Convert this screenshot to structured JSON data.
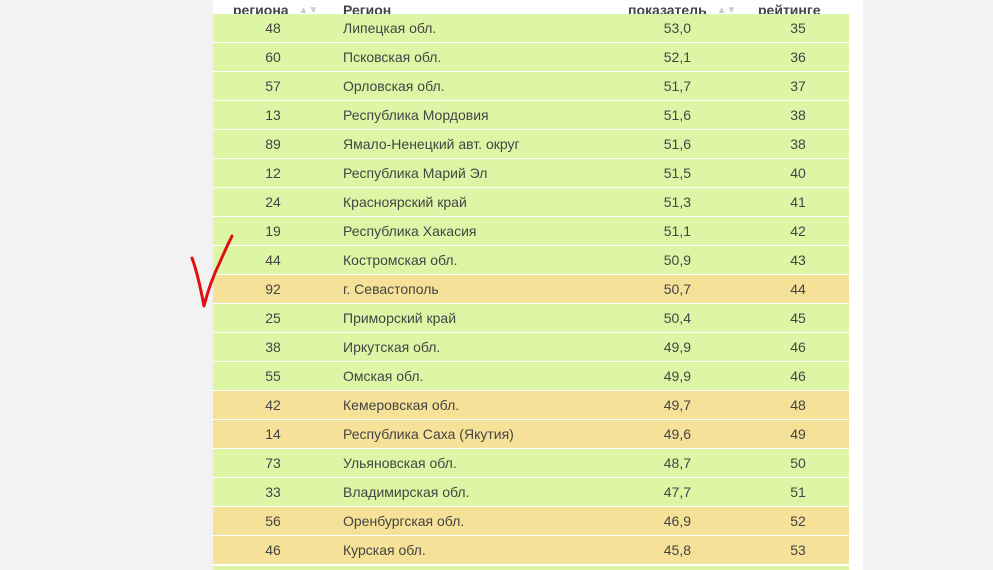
{
  "table": {
    "headers": {
      "code": "региона",
      "region": "Регион",
      "value": "показатель",
      "rank": "рейтинге"
    },
    "rows": [
      {
        "code": "48",
        "region": "Липецкая обл.",
        "value": "53,0",
        "rank": "35",
        "color": "green"
      },
      {
        "code": "60",
        "region": "Псковская обл.",
        "value": "52,1",
        "rank": "36",
        "color": "green"
      },
      {
        "code": "57",
        "region": "Орловская обл.",
        "value": "51,7",
        "rank": "37",
        "color": "green"
      },
      {
        "code": "13",
        "region": "Республика Мордовия",
        "value": "51,6",
        "rank": "38",
        "color": "green"
      },
      {
        "code": "89",
        "region": "Ямало-Ненецкий авт. округ",
        "value": "51,6",
        "rank": "38",
        "color": "green"
      },
      {
        "code": "12",
        "region": "Республика Марий Эл",
        "value": "51,5",
        "rank": "40",
        "color": "green"
      },
      {
        "code": "24",
        "region": "Красноярский край",
        "value": "51,3",
        "rank": "41",
        "color": "green"
      },
      {
        "code": "19",
        "region": "Республика Хакасия",
        "value": "51,1",
        "rank": "42",
        "color": "green"
      },
      {
        "code": "44",
        "region": "Костромская обл.",
        "value": "50,9",
        "rank": "43",
        "color": "green"
      },
      {
        "code": "92",
        "region": "г. Севастополь",
        "value": "50,7",
        "rank": "44",
        "color": "yellow"
      },
      {
        "code": "25",
        "region": "Приморский край",
        "value": "50,4",
        "rank": "45",
        "color": "green"
      },
      {
        "code": "38",
        "region": "Иркутская обл.",
        "value": "49,9",
        "rank": "46",
        "color": "green"
      },
      {
        "code": "55",
        "region": "Омская обл.",
        "value": "49,9",
        "rank": "46",
        "color": "green"
      },
      {
        "code": "42",
        "region": "Кемеровская обл.",
        "value": "49,7",
        "rank": "48",
        "color": "yellow"
      },
      {
        "code": "14",
        "region": "Республика Саха (Якутия)",
        "value": "49,6",
        "rank": "49",
        "color": "yellow"
      },
      {
        "code": "73",
        "region": "Ульяновская обл.",
        "value": "48,7",
        "rank": "50",
        "color": "green"
      },
      {
        "code": "33",
        "region": "Владимирская обл.",
        "value": "47,7",
        "rank": "51",
        "color": "green"
      },
      {
        "code": "56",
        "region": "Оренбургская обл.",
        "value": "46,9",
        "rank": "52",
        "color": "yellow"
      },
      {
        "code": "46",
        "region": "Курская обл.",
        "value": "45,8",
        "rank": "53",
        "color": "yellow"
      }
    ]
  },
  "colors": {
    "green_row": "#ddf6a6",
    "yellow_row": "#f5e197",
    "annotation": "#e01010"
  }
}
